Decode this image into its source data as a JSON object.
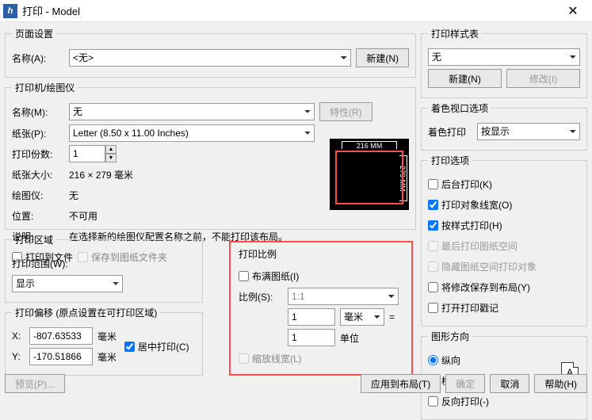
{
  "window": {
    "title": "打印 - Model",
    "icon_letter": "h"
  },
  "page_setup": {
    "legend": "页面设置",
    "name_label": "名称(A):",
    "name_value": "<无>",
    "new_btn": "新建(N)"
  },
  "printer": {
    "legend": "打印机/绘图仪",
    "name_label": "名称(M):",
    "name_value": "无",
    "props_btn": "特性(R)",
    "paper_label": "纸张(P):",
    "paper_value": "Letter (8.50 x 11.00 Inches)",
    "copies_label": "打印份数:",
    "copies_value": "1",
    "size_label": "纸张大小:",
    "size_value": "216 × 279  毫米",
    "plotter_label": "绘图仪:",
    "plotter_value": "无",
    "location_label": "位置:",
    "location_value": "不可用",
    "note_label": "说明:",
    "note_value": "在选择新的绘图仪配置名称之前，不能打印该布局。",
    "to_file": "打印到文件",
    "save_folder": "保存到图纸文件夹",
    "preview_w": "216 MM",
    "preview_h": "279 MM"
  },
  "area": {
    "legend": "打印区域",
    "range_label": "打印范围(W):",
    "range_value": "显示"
  },
  "scale": {
    "legend": "打印比例",
    "fit_paper": "布满图纸(I)",
    "ratio_label": "比例(S):",
    "ratio_value": "1:1",
    "val1": "1",
    "unit1": "毫米",
    "equals": "=",
    "val2": "1",
    "unit2": "单位",
    "scale_lw": "缩放线宽(L)"
  },
  "offset": {
    "legend": "打印偏移 (原点设置在可打印区域)",
    "x_label": "X:",
    "x_value": "-807.63533",
    "x_unit": "毫米",
    "y_label": "Y:",
    "y_value": "-170.51866",
    "y_unit": "毫米",
    "center": "居中打印(C)"
  },
  "style": {
    "legend": "打印样式表",
    "value": "无",
    "new_btn": "新建(N)",
    "edit_btn": "修改(I)"
  },
  "shade": {
    "legend": "着色视口选项",
    "label": "着色打印",
    "value": "按显示"
  },
  "options": {
    "legend": "打印选项",
    "bg": "后台打印(K)",
    "lw": "打印对象线宽(O)",
    "bystyle": "按样式打印(H)",
    "last_space": "最后打印图纸空间",
    "hide_space": "隐藏图纸空间打印对象",
    "save_layout": "将修改保存到布局(Y)",
    "stamp": "打开打印戳记"
  },
  "orient": {
    "legend": "图形方向",
    "portrait": "纵向",
    "landscape": "横向",
    "reverse": "反向打印(-)",
    "icon_letter": "A"
  },
  "footer": {
    "preview": "预览(P)...",
    "apply": "应用到布局(T)",
    "ok": "确定",
    "cancel": "取消",
    "help": "帮助(H)"
  }
}
